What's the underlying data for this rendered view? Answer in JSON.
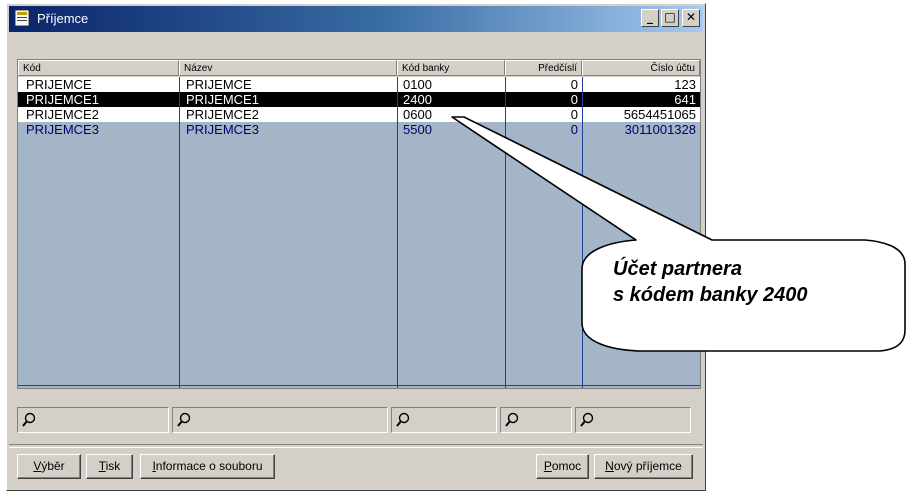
{
  "window": {
    "title": "Příjemce",
    "minimize_glyph": "_",
    "maximize_glyph": "□",
    "close_glyph": "✕"
  },
  "table": {
    "columns": [
      "Kód",
      "Název",
      "Kód banky",
      "Předčíslí",
      "Číslo účtu"
    ],
    "rows": [
      [
        "PRIJEMCE",
        "PRIJEMCE",
        "0100",
        "0",
        "123"
      ],
      [
        "PRIJEMCE1",
        "PRIJEMCE1",
        "2400",
        "0",
        "641"
      ],
      [
        "PRIJEMCE2",
        "PRIJEMCE2",
        "0600",
        "0",
        "5654451065"
      ],
      [
        "PRIJEMCE3",
        "PRIJEMCE3",
        "5500",
        "0",
        "3011001328"
      ]
    ],
    "selected_row": 1
  },
  "filters": {
    "icon": "magnifier-icon"
  },
  "buttons": {
    "vyber": "Výběr",
    "tisk": "Tisk",
    "informace": "Informace o souboru",
    "pomoc": "Pomoc",
    "novy": "Nový příjemce"
  },
  "callout": {
    "line1": "Účet partnera",
    "line2": "s kódem banky 2400"
  },
  "colors": {
    "titlebar_start": "#0a246a",
    "grid_background": "#a4b5c8",
    "window_face": "#d4d0c8"
  }
}
